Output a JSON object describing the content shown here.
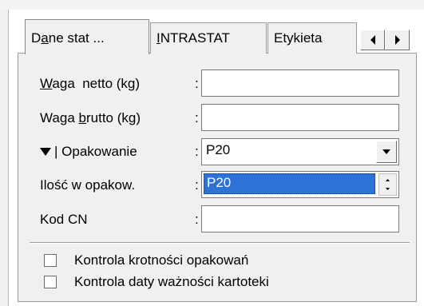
{
  "tabs": [
    {
      "label": "Dane stat ...",
      "underline_char": "a",
      "active": true
    },
    {
      "label": "INTRASTAT",
      "underline_char": "I",
      "active": false
    },
    {
      "label": "Etykieta",
      "active": false
    }
  ],
  "tab_scroll": {
    "left_icon": "left-arrow-icon",
    "right_icon": "right-arrow-icon"
  },
  "fields": {
    "waga_netto": {
      "label_u": "W",
      "label_rest": "aga  netto (kg)",
      "colon": ":",
      "value": ""
    },
    "waga_brutto": {
      "label_pre": "Waga ",
      "label_u": "b",
      "label_rest": "rutto (kg)",
      "colon": ":",
      "value": ""
    },
    "opakowanie": {
      "label": "| Opakowanie",
      "colon": ":",
      "value": "P20",
      "dropdown_icon": "chevron-down-icon"
    },
    "ilosc": {
      "label": "Ilość w opakow.",
      "colon": ":",
      "selected_value": "P20"
    },
    "kod_cn": {
      "label": "Kod CN",
      "colon": ":",
      "value": ""
    }
  },
  "checkboxes": [
    {
      "label": "Kontrola krotności opakowań",
      "checked": false
    },
    {
      "label": "Kontrola daty ważności kartoteki",
      "checked": false
    }
  ]
}
